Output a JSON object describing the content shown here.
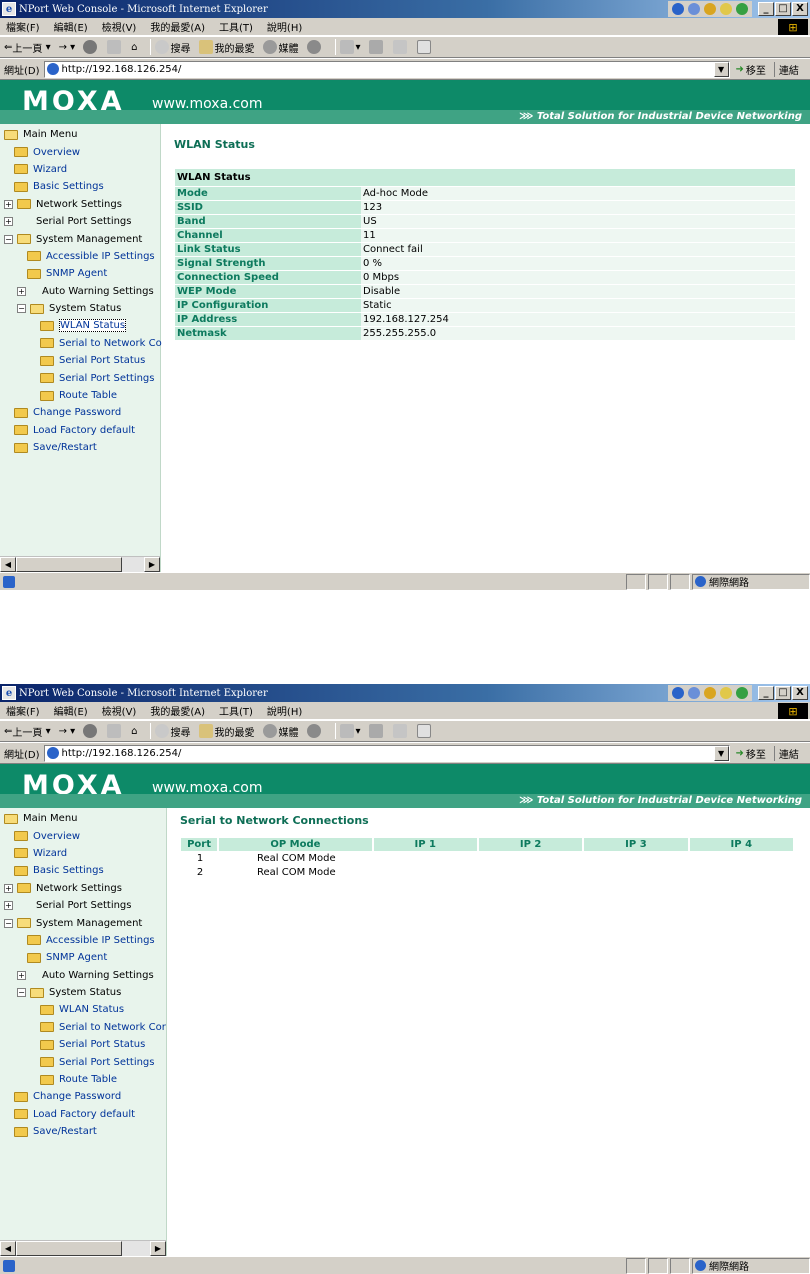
{
  "browser": {
    "title": "NPort Web Console - Microsoft Internet Explorer",
    "menu": [
      "檔案(F)",
      "編輯(E)",
      "檢視(V)",
      "我的最愛(A)",
      "工具(T)",
      "說明(H)"
    ],
    "toolbar": {
      "back": "上一頁",
      "search": "搜尋",
      "favorites": "我的最愛",
      "media": "媒體"
    },
    "address_label": "網址(D)",
    "url": "http://192.168.126.254/",
    "go_label": "移至",
    "links_label": "連結",
    "status_zone": "網際網路",
    "window_buttons": {
      "minimize": "_",
      "maximize": "□",
      "close": "X"
    }
  },
  "banner": {
    "logo": "MOXA",
    "url": "www.moxa.com",
    "tagline": "Total Solution for Industrial Device Networking"
  },
  "nav": {
    "main_menu": "Main Menu",
    "overview": "Overview",
    "wizard": "Wizard",
    "basic_settings": "Basic Settings",
    "network_settings": "Network Settings",
    "serial_port_settings": "Serial Port Settings",
    "system_management": "System Management",
    "accessible_ip_settings": "Accessible IP Settings",
    "snmp_agent": "SNMP Agent",
    "auto_warning_settings": "Auto Warning Settings",
    "system_status": "System Status",
    "wlan_status": "WLAN Status",
    "serial_to_network_short": "Serial to Network Co",
    "serial_to_network_short2": "Serial to Network Cor",
    "serial_port_status": "Serial Port Status",
    "serial_port_settings_sub": "Serial Port Settings",
    "route_table": "Route Table",
    "change_password": "Change Password",
    "load_factory_default": "Load Factory default",
    "save_restart": "Save/Restart"
  },
  "wlan_page": {
    "title": "WLAN Status",
    "table_header": "WLAN Status",
    "rows": [
      {
        "key": "Mode",
        "value": "Ad-hoc Mode"
      },
      {
        "key": "SSID",
        "value": "123"
      },
      {
        "key": "Band",
        "value": "US"
      },
      {
        "key": "Channel",
        "value": "11"
      },
      {
        "key": "Link Status",
        "value": "Connect fail"
      },
      {
        "key": "Signal Strength",
        "value": "0 %"
      },
      {
        "key": "Connection Speed",
        "value": "0 Mbps"
      },
      {
        "key": "WEP Mode",
        "value": "Disable"
      },
      {
        "key": "IP Configuration",
        "value": "Static"
      },
      {
        "key": "IP Address",
        "value": "192.168.127.254"
      },
      {
        "key": "Netmask",
        "value": "255.255.255.0"
      }
    ]
  },
  "conn_page": {
    "title": "Serial to Network Connections",
    "headers": [
      "Port",
      "OP Mode",
      "IP 1",
      "IP 2",
      "IP 3",
      "IP 4"
    ],
    "rows": [
      {
        "port": "1",
        "mode": "Real COM Mode"
      },
      {
        "port": "2",
        "mode": "Real COM Mode"
      }
    ]
  },
  "colors": {
    "brand_green": "#0d8a68",
    "header_mint": "#c6ebda",
    "link_blue": "#003399"
  }
}
